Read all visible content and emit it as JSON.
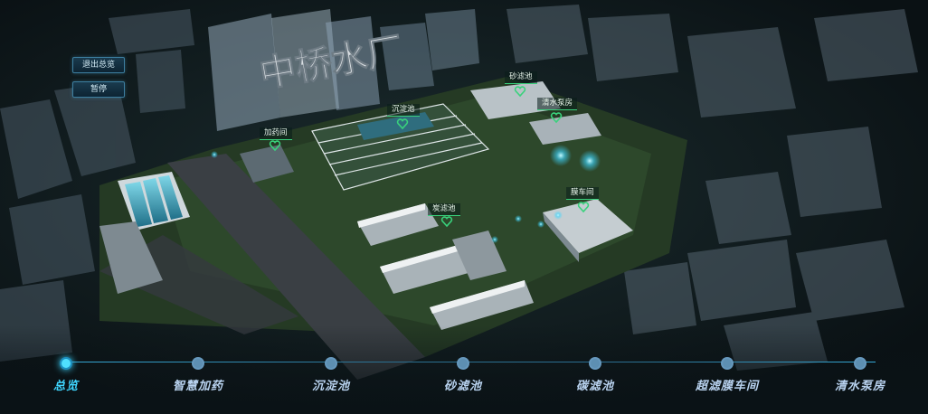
{
  "plant": {
    "title": "中桥水厂"
  },
  "controls": {
    "exit_label": "退出总览",
    "pause_label": "暂停"
  },
  "markers": [
    {
      "id": "chemical-dosing",
      "label": "加药间"
    },
    {
      "id": "sedimentation",
      "label": "沉淀池"
    },
    {
      "id": "sand-filter",
      "label": "砂滤池"
    },
    {
      "id": "clear-pump",
      "label": "清水泵房"
    },
    {
      "id": "carbon-filter",
      "label": "炭滤池"
    },
    {
      "id": "membrane",
      "label": "膜车间"
    }
  ],
  "nav": {
    "active_index": 0,
    "items": [
      {
        "label": "总览"
      },
      {
        "label": "智慧加药"
      },
      {
        "label": "沉淀池"
      },
      {
        "label": "砂滤池"
      },
      {
        "label": "碳滤池"
      },
      {
        "label": "超滤膜车间"
      },
      {
        "label": "清水泵房"
      }
    ]
  },
  "colors": {
    "accent": "#3fd6ff",
    "marker_green": "#39d27c",
    "nav_text": "#b9d3f0",
    "background": "#0c1418"
  },
  "icons": {
    "marker": "heart-location-icon",
    "nav_dot": "circle-icon"
  }
}
